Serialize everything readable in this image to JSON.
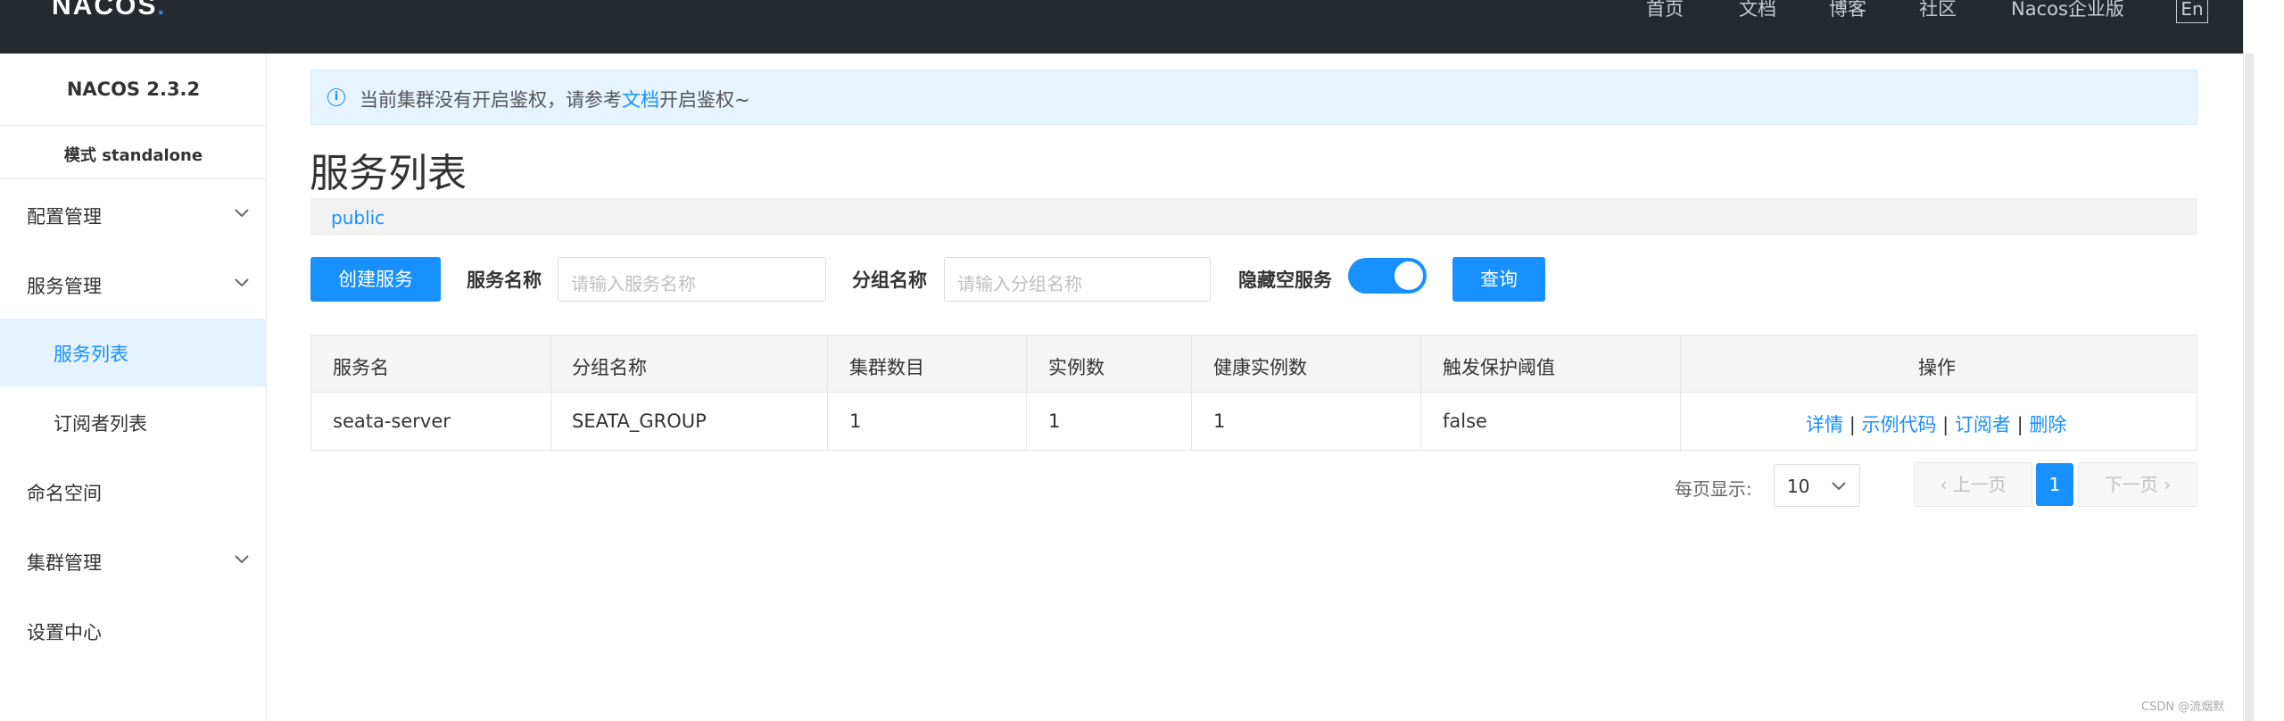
{
  "topbar": {
    "logo": "NACOS",
    "nav": [
      "首页",
      "文档",
      "博客",
      "社区",
      "Nacos企业版"
    ],
    "lang": "En"
  },
  "sidebar": {
    "version": "NACOS 2.3.2",
    "mode": "模式 standalone",
    "items": [
      {
        "label": "配置管理",
        "expandable": true
      },
      {
        "label": "服务管理",
        "expandable": true
      },
      {
        "label": "服务列表",
        "active": true
      },
      {
        "label": "订阅者列表"
      },
      {
        "label": "命名空间"
      },
      {
        "label": "集群管理",
        "expandable": true
      },
      {
        "label": "设置中心"
      }
    ]
  },
  "notice": {
    "text_before": "当前集群没有开启鉴权，请参考",
    "link": "文档",
    "text_after": "开启鉴权~"
  },
  "page_title": "服务列表",
  "namespace": "public",
  "toolbar": {
    "create_label": "创建服务",
    "service_name_label": "服务名称",
    "service_name_placeholder": "请输入服务名称",
    "group_name_label": "分组名称",
    "group_name_placeholder": "请输入分组名称",
    "hide_empty_label": "隐藏空服务",
    "hide_empty_on": true,
    "query_label": "查询"
  },
  "table": {
    "headers": [
      "服务名",
      "分组名称",
      "集群数目",
      "实例数",
      "健康实例数",
      "触发保护阈值",
      "操作"
    ],
    "rows": [
      {
        "service": "seata-server",
        "group": "SEATA_GROUP",
        "clusters": "1",
        "instances": "1",
        "healthy": "1",
        "threshold": "false",
        "ops": [
          "详情",
          "示例代码",
          "订阅者",
          "删除"
        ]
      }
    ]
  },
  "pagination": {
    "per_page_label": "每页显示:",
    "per_page_value": "10",
    "prev": "上一页",
    "current": "1",
    "next": "下一页"
  },
  "watermark": "CSDN @流烟默",
  "colors": {
    "accent": "#1890ff",
    "topbar": "#252a2f"
  }
}
